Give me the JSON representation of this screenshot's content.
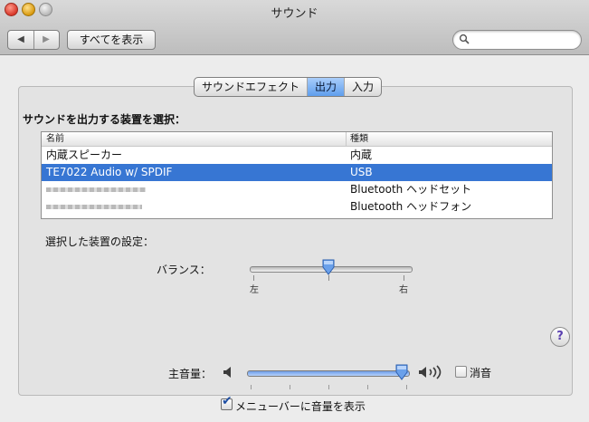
{
  "window": {
    "title": "サウンド"
  },
  "toolbar": {
    "back_icon": "◀",
    "forward_icon": "▶",
    "show_all_label": "すべてを表示",
    "search_placeholder": ""
  },
  "tabs": [
    {
      "label": "サウンドエフェクト",
      "selected": false
    },
    {
      "label": "出力",
      "selected": true
    },
    {
      "label": "入力",
      "selected": false
    }
  ],
  "output": {
    "heading": "サウンドを出力する装置を選択：",
    "columns": {
      "name": "名前",
      "type": "種類"
    },
    "devices": [
      {
        "name": "内蔵スピーカー",
        "type": "内蔵",
        "selected": false,
        "name_redacted": false
      },
      {
        "name": "TE7022 Audio w/ SPDIF",
        "type": "USB",
        "selected": true,
        "name_redacted": false
      },
      {
        "name": "",
        "type": "Bluetooth ヘッドセット",
        "selected": false,
        "name_redacted": true
      },
      {
        "name": "",
        "type": "Bluetooth ヘッドフォン",
        "selected": false,
        "name_redacted": true
      }
    ],
    "settings_heading": "選択した装置の設定：",
    "balance": {
      "label": "バランス：",
      "left_label": "左",
      "right_label": "右",
      "value": 0.45
    }
  },
  "help": {
    "symbol": "?"
  },
  "volume": {
    "label": "主音量：",
    "value": 0.92,
    "mute_label": "消音",
    "muted": false
  },
  "menubar": {
    "label": "メニューバーに音量を表示",
    "checked": true,
    "check_mark": "✔"
  },
  "colors": {
    "selection": "#3776d3",
    "tab_selected": "#5f9eed",
    "background": "#ececec"
  }
}
